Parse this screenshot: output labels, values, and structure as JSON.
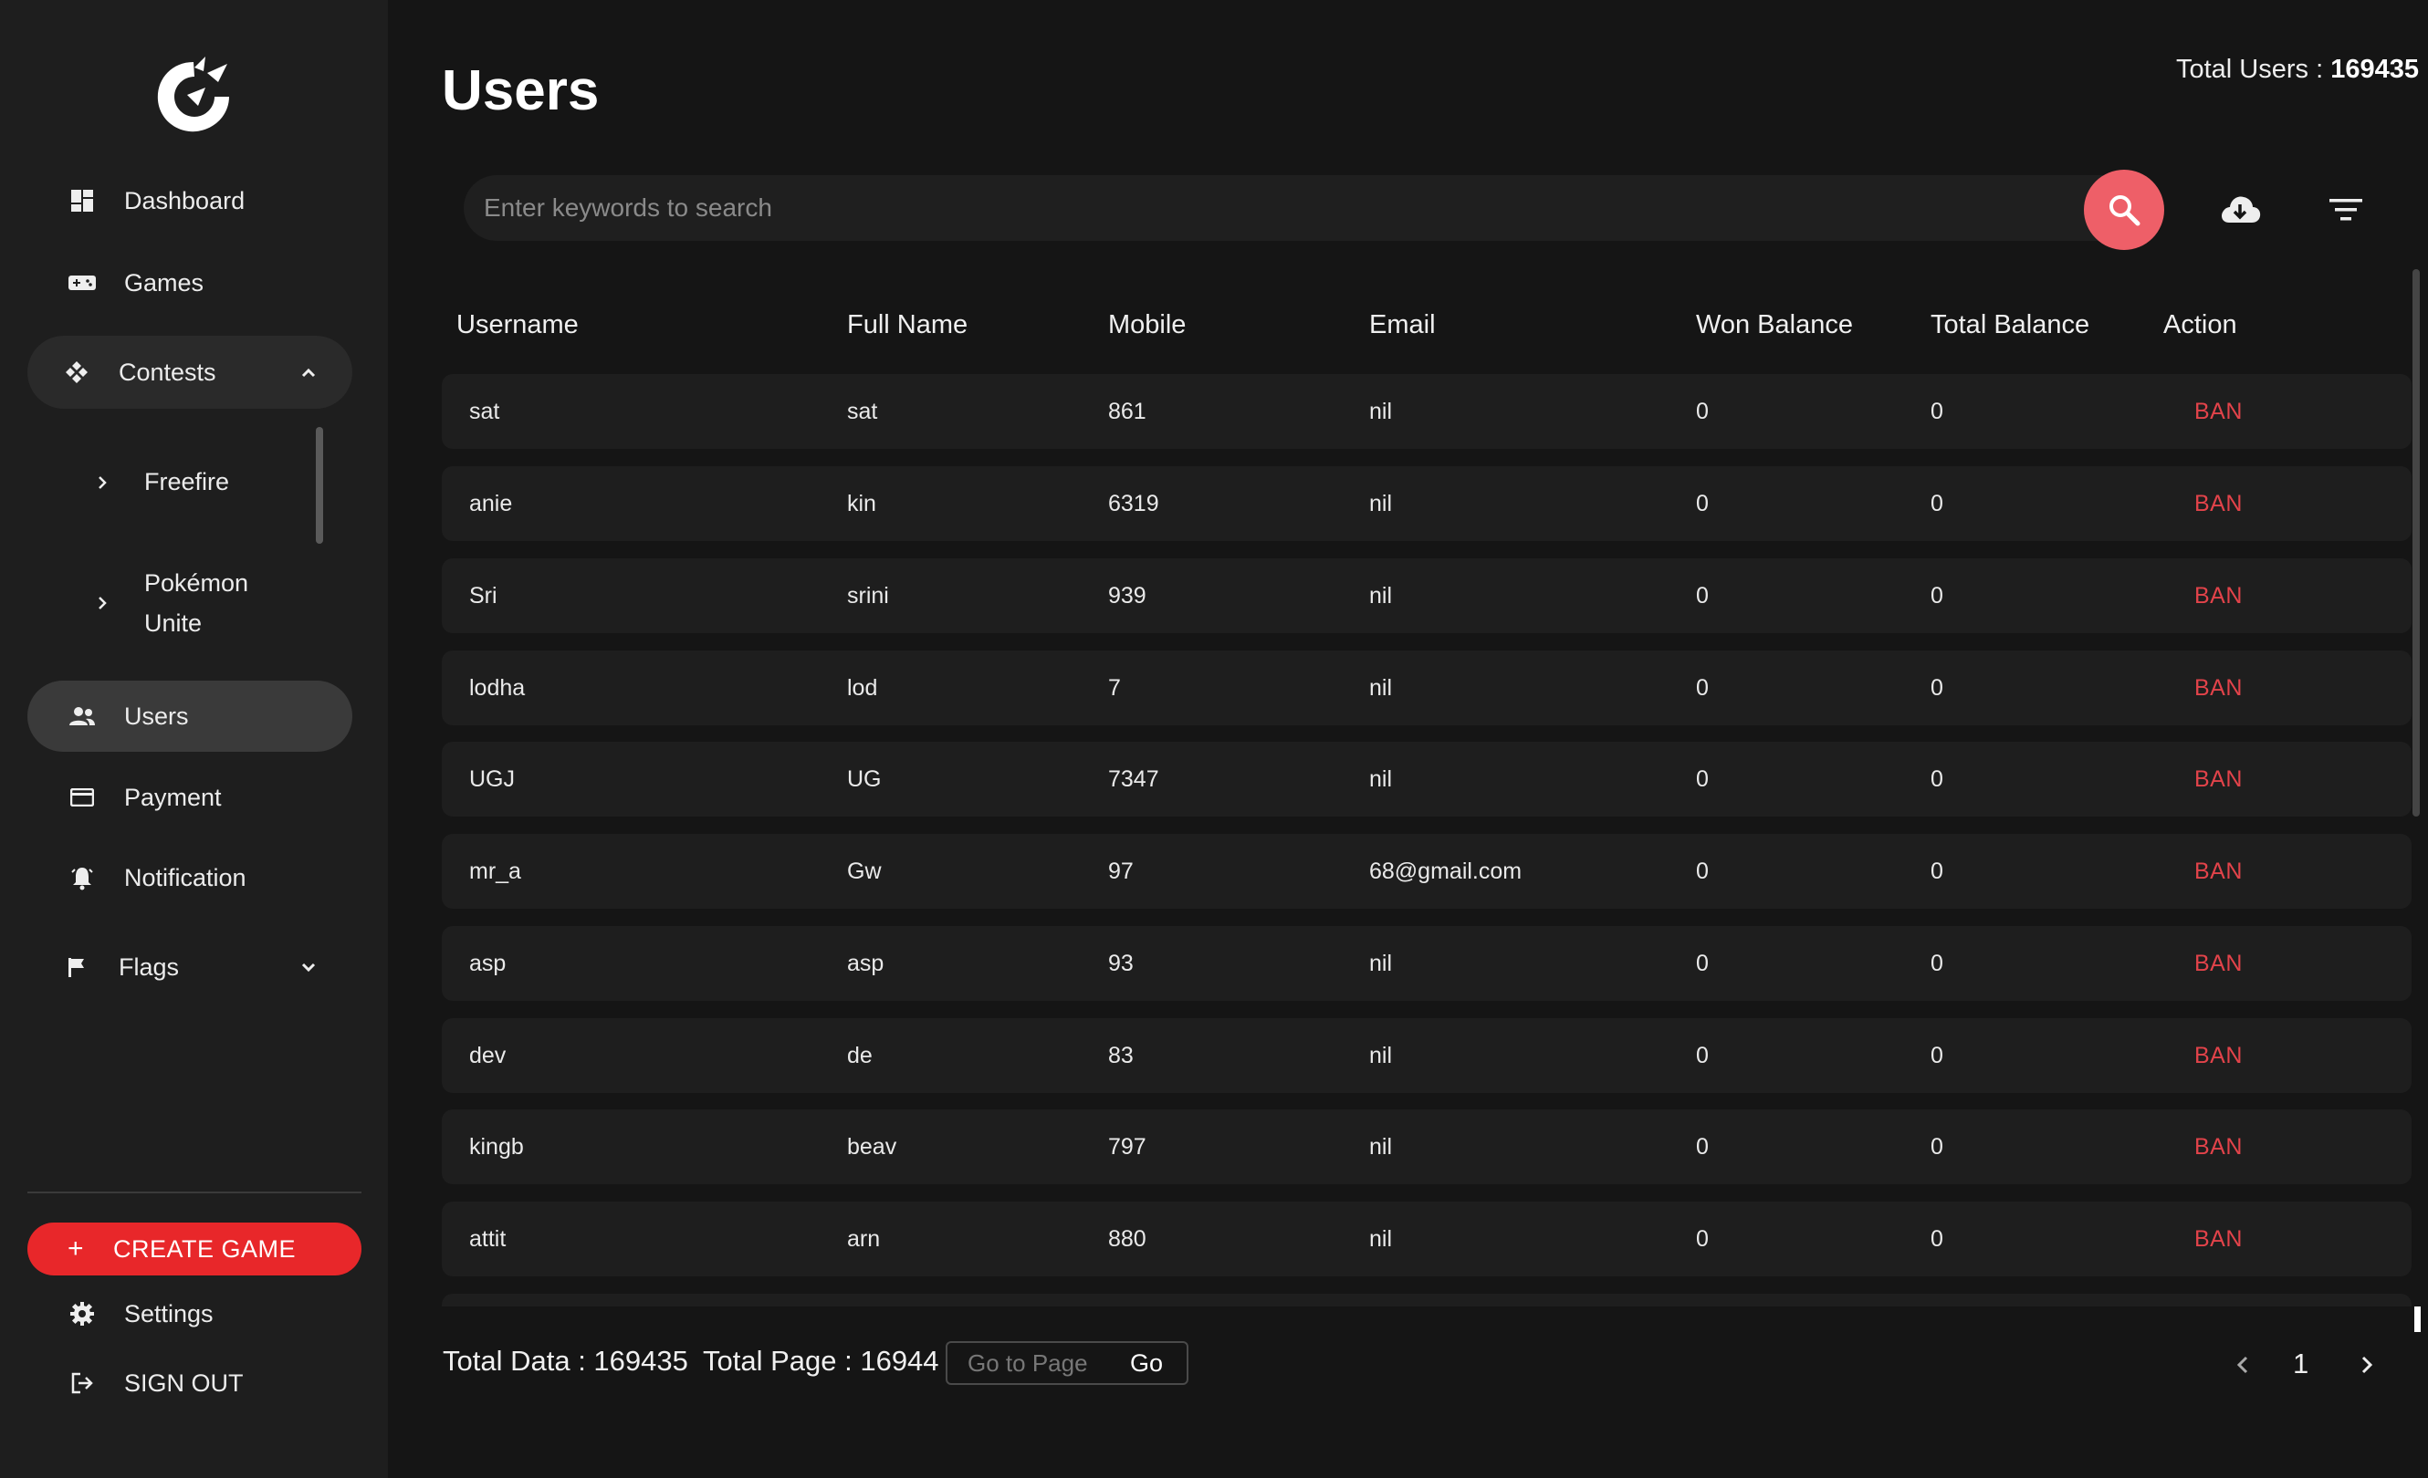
{
  "sidebar": {
    "items": [
      {
        "label": "Dashboard",
        "icon": "dashboard-icon"
      },
      {
        "label": "Games",
        "icon": "gamepad-icon"
      },
      {
        "label": "Contests",
        "icon": "contests-icon"
      },
      {
        "label": "Users",
        "icon": "users-icon"
      },
      {
        "label": "Payment",
        "icon": "credit-card-icon"
      },
      {
        "label": "Notification",
        "icon": "bell-icon"
      },
      {
        "label": "Flags",
        "icon": "flag-icon"
      }
    ],
    "contest_children": [
      "Freefire",
      "Pokémon",
      "Unite"
    ],
    "create_label": "CREATE GAME",
    "settings_label": "Settings",
    "signout_label": "SIGN OUT"
  },
  "header": {
    "title": "Users",
    "total_users_label": "Total Users :",
    "total_users_value": "169435"
  },
  "search": {
    "placeholder": "Enter keywords to search"
  },
  "table": {
    "columns": [
      "Username",
      "Full Name",
      "Mobile",
      "Email",
      "Won Balance",
      "Total Balance",
      "Action"
    ],
    "rows": [
      {
        "username": "sat",
        "full_name": "sat",
        "mobile": "861",
        "email": "nil",
        "won": "0",
        "total": "0",
        "action": "BAN"
      },
      {
        "username": "anie",
        "full_name": "kin",
        "mobile": "6319",
        "email": "nil",
        "won": "0",
        "total": "0",
        "action": "BAN"
      },
      {
        "username": "Sri",
        "full_name": "srini",
        "mobile": "939",
        "email": "nil",
        "won": "0",
        "total": "0",
        "action": "BAN"
      },
      {
        "username": "lodha",
        "full_name": "lod",
        "mobile": "7",
        "email": "nil",
        "won": "0",
        "total": "0",
        "action": "BAN"
      },
      {
        "username": "UGJ",
        "full_name": "UG",
        "mobile": "7347",
        "email": "nil",
        "won": "0",
        "total": "0",
        "action": "BAN"
      },
      {
        "username": "mr_a",
        "full_name": "Gw",
        "mobile": "97",
        "email": "68@gmail.com",
        "won": "0",
        "total": "0",
        "action": "BAN"
      },
      {
        "username": "asp",
        "full_name": "asp",
        "mobile": "93",
        "email": "nil",
        "won": "0",
        "total": "0",
        "action": "BAN"
      },
      {
        "username": "dev",
        "full_name": "de",
        "mobile": "83",
        "email": "nil",
        "won": "0",
        "total": "0",
        "action": "BAN"
      },
      {
        "username": "kingb",
        "full_name": "beav",
        "mobile": "797",
        "email": "nil",
        "won": "0",
        "total": "0",
        "action": "BAN"
      },
      {
        "username": "attit",
        "full_name": "arn",
        "mobile": "880",
        "email": "nil",
        "won": "0",
        "total": "0",
        "action": "BAN"
      }
    ]
  },
  "pagination": {
    "total_data": "Total Data : 169435",
    "total_page": "Total Page : 16944",
    "goto_placeholder": "Go to Page",
    "go_label": "Go",
    "current_page": "1"
  },
  "colors": {
    "accent": "#e8272a",
    "ban": "#e2434a",
    "search_button": "#ee5f68"
  }
}
